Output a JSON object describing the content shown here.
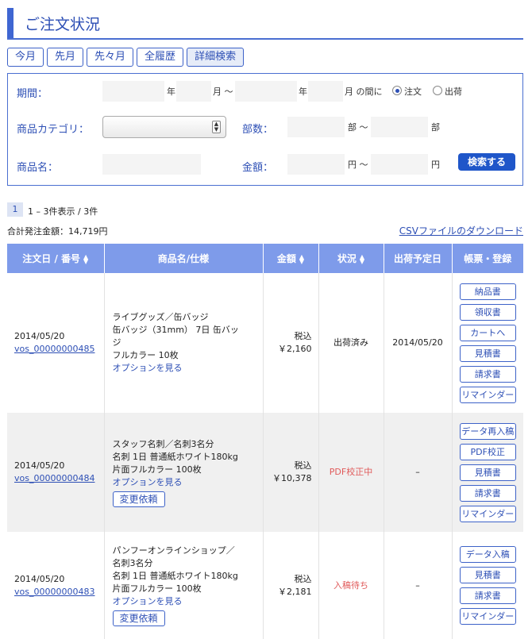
{
  "page": {
    "title": "ご注文状況"
  },
  "tabs": [
    {
      "label": "今月"
    },
    {
      "label": "先月"
    },
    {
      "label": "先々月"
    },
    {
      "label": "全履歴"
    },
    {
      "label": "詳細検索"
    }
  ],
  "search": {
    "period_label": "期間：",
    "year_unit": "年",
    "month_unit": "月 〜",
    "year_unit2": "年",
    "month_unit2": "月 の間に",
    "radio_order": "注文",
    "radio_ship": "出荷",
    "category_label": "商品カテゴリ：",
    "category_value": "",
    "copies_label": "部数：",
    "copies_from_unit": "部 〜",
    "copies_to_unit": "部",
    "product_label": "商品名：",
    "amount_label": "金額：",
    "amount_from_unit": "円 〜",
    "amount_to_unit": "円",
    "submit": "検索する"
  },
  "pager": {
    "current": "1",
    "summary": "1 – 3件表示 / 3件"
  },
  "total": "合計発注金額：14,719円",
  "csv_link": "CSVファイルのダウンロード",
  "table": {
    "headers": {
      "date": "注文日 / 番号",
      "product": "商品名/仕様",
      "amount": "金額",
      "status": "状況",
      "ship": "出荷予定日",
      "docs": "帳票・登録"
    },
    "rows": [
      {
        "date": "2014/05/20",
        "order_no": "vos_00000000485",
        "product_lines": [
          "ライブグッズ／缶バッジ",
          "缶バッジ（31mm） 7日 缶バッ",
          "ジ",
          "フルカラー 10枚"
        ],
        "option": "オプションを見る",
        "tax": "税込",
        "amount": "￥2,160",
        "status": "出荷済み",
        "ship": "2014/05/20",
        "buttons": [
          "納品書",
          "領収書",
          "カートへ",
          "見積書",
          "請求書",
          "リマインダー"
        ]
      },
      {
        "date": "2014/05/20",
        "order_no": "vos_00000000484",
        "product_lines": [
          "スタッフ名刺／名刺3名分",
          "名刺 1日 普通紙ホワイト180kg",
          "片面フルカラー 100枚"
        ],
        "option": "オプションを見る",
        "change": "変更依頼",
        "tax": "税込",
        "amount": "￥10,378",
        "status": "PDF校正中",
        "ship": "–",
        "buttons": [
          "データ再入稿",
          "PDF校正",
          "見積書",
          "請求書",
          "リマインダー"
        ]
      },
      {
        "date": "2014/05/20",
        "order_no": "vos_00000000483",
        "product_lines": [
          "パンフーオンラインショップ／",
          "名刺3名分",
          "名刺 1日 普通紙ホワイト180kg",
          "片面フルカラー 100枚"
        ],
        "option": "オプションを見る",
        "change": "変更依頼",
        "tax": "税込",
        "amount": "￥2,181",
        "status": "入稿待ち",
        "ship": "–",
        "buttons": [
          "データ入稿",
          "見積書",
          "請求書",
          "リマインダー"
        ]
      }
    ]
  },
  "colors": {
    "accent": "#3f66d2",
    "header_bg": "#7e9bea",
    "status_red": "#e05a5a",
    "button_blue": "#1f56c9"
  }
}
